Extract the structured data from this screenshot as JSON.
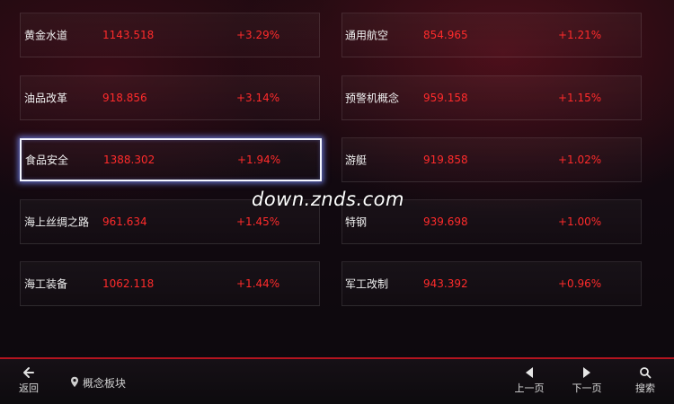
{
  "concepts": {
    "left": [
      {
        "name": "黄金水道",
        "price": "1143.518",
        "change": "+3.29%"
      },
      {
        "name": "油品改革",
        "price": "918.856",
        "change": "+3.14%"
      },
      {
        "name": "食品安全",
        "price": "1388.302",
        "change": "+1.94%"
      },
      {
        "name": "海上丝绸之路",
        "price": "961.634",
        "change": "+1.45%"
      },
      {
        "name": "海工装备",
        "price": "1062.118",
        "change": "+1.44%"
      }
    ],
    "right": [
      {
        "name": "通用航空",
        "price": "854.965",
        "change": "+1.21%"
      },
      {
        "name": "预警机概念",
        "price": "959.158",
        "change": "+1.15%"
      },
      {
        "name": "游艇",
        "price": "919.858",
        "change": "+1.02%"
      },
      {
        "name": "特钢",
        "price": "939.698",
        "change": "+1.00%"
      },
      {
        "name": "军工改制",
        "price": "943.392",
        "change": "+0.96%"
      }
    ]
  },
  "colors": {
    "up": "#ff2b2b",
    "accent_line": "#b3141f",
    "focus": "#f4f6ff"
  },
  "watermark": "down.znds.com",
  "footer": {
    "back_label": "返回",
    "breadcrumb": "概念板块",
    "prev_label": "上一页",
    "next_label": "下一页",
    "search_label": "搜索",
    "icons": {
      "back": "back-arrow-icon",
      "location": "location-pin-icon",
      "prev": "triangle-left-icon",
      "next": "triangle-right-icon",
      "search": "search-icon"
    }
  }
}
